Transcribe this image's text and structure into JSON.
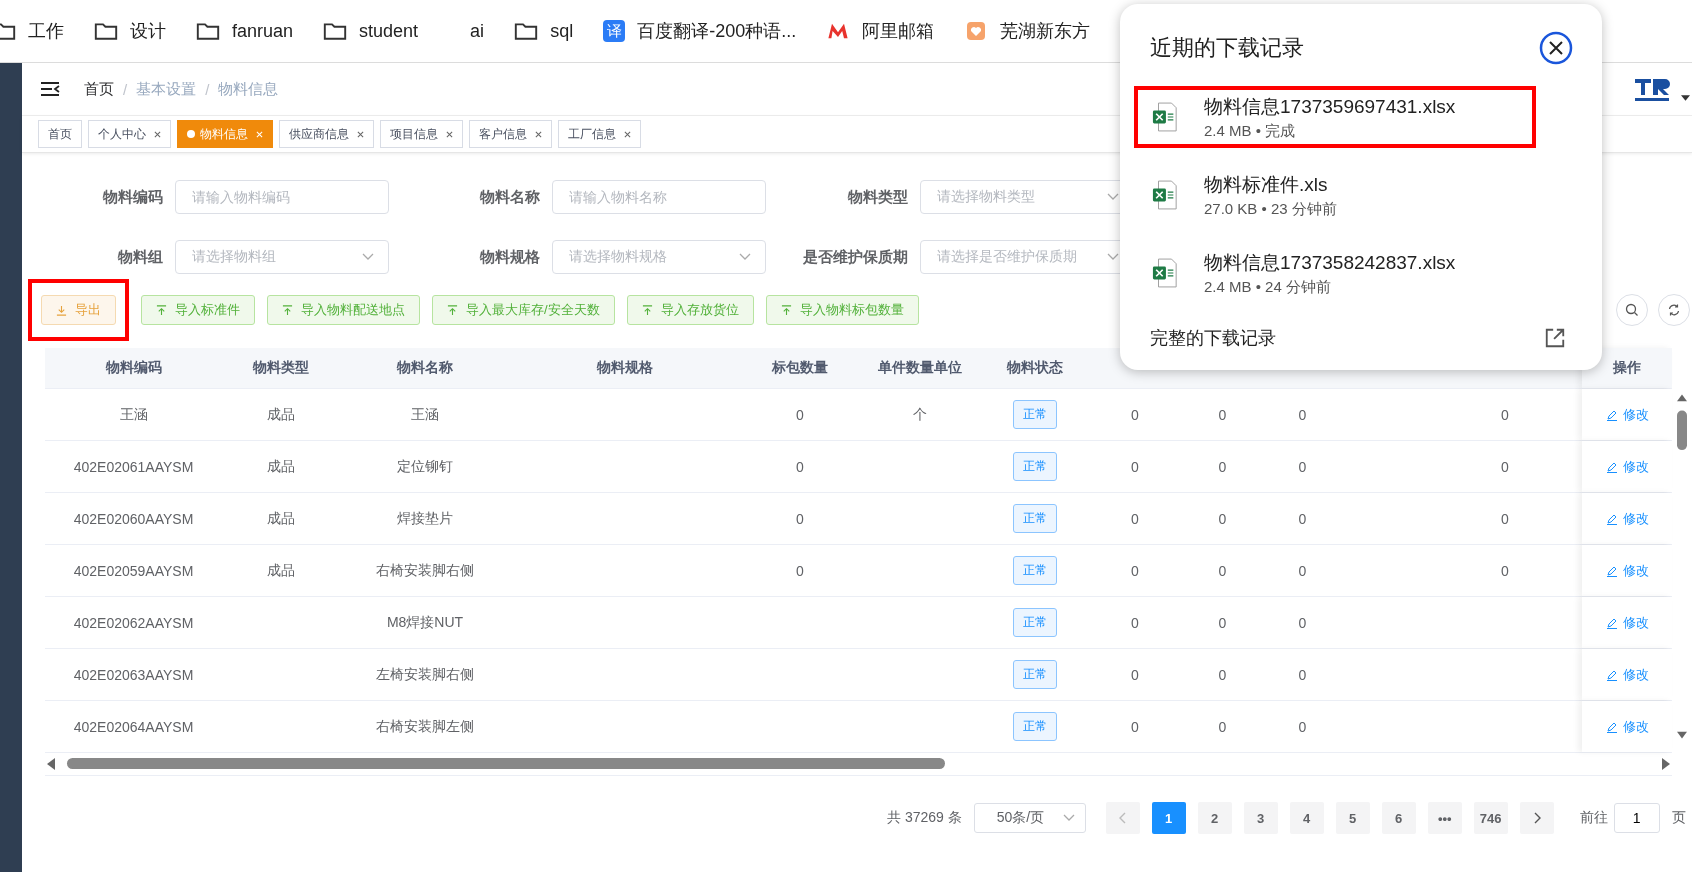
{
  "bookmarks": [
    {
      "kind": "folder",
      "label": "工作"
    },
    {
      "kind": "folder",
      "label": "设计"
    },
    {
      "kind": "folder",
      "label": "fanruan"
    },
    {
      "kind": "folder",
      "label": "student"
    },
    {
      "kind": "plain",
      "label": "ai"
    },
    {
      "kind": "folder",
      "label": "sql"
    },
    {
      "kind": "translate",
      "badge": "译",
      "label": "百度翻译-200种语..."
    },
    {
      "kind": "mail",
      "label": "阿里邮箱"
    },
    {
      "kind": "site",
      "label": "芜湖新东方"
    }
  ],
  "breadcrumb": {
    "items": [
      "首页",
      "基本设置",
      "物料信息"
    ],
    "separators": [
      "/",
      "/"
    ]
  },
  "tags": [
    {
      "label": "首页",
      "selected": false,
      "closable": false
    },
    {
      "label": "个人中心",
      "selected": false,
      "closable": true
    },
    {
      "label": "物料信息",
      "selected": true,
      "closable": true
    },
    {
      "label": "供应商信息",
      "selected": false,
      "closable": true
    },
    {
      "label": "项目信息",
      "selected": false,
      "closable": true
    },
    {
      "label": "客户信息",
      "selected": false,
      "closable": true
    },
    {
      "label": "工厂信息",
      "selected": false,
      "closable": true
    }
  ],
  "filters": [
    {
      "kind": "input",
      "label": "物料编码",
      "placeholder": "请输入物料编码"
    },
    {
      "kind": "input",
      "label": "物料名称",
      "placeholder": "请输入物料名称"
    },
    {
      "kind": "select",
      "label": "物料类型",
      "placeholder": "请选择物料类型"
    },
    {
      "kind": "select",
      "label": "物料组",
      "placeholder": "请选择物料组"
    },
    {
      "kind": "select",
      "label": "物料规格",
      "placeholder": "请选择物料规格"
    },
    {
      "kind": "select",
      "label": "是否维护保质期",
      "placeholder": "请选择是否维护保质期"
    }
  ],
  "toolbar": [
    {
      "kind": "export",
      "label": "导出",
      "highlighted": true
    },
    {
      "kind": "import",
      "label": "导入标准件",
      "highlighted": false
    },
    {
      "kind": "import",
      "label": "导入物料配送地点",
      "highlighted": false
    },
    {
      "kind": "import",
      "label": "导入最大库存/安全天数",
      "highlighted": false
    },
    {
      "kind": "import",
      "label": "导入存放货位",
      "highlighted": false
    },
    {
      "kind": "import",
      "label": "导入物料标包数量",
      "highlighted": false
    }
  ],
  "table": {
    "columns": [
      "物料编码",
      "物料类型",
      "物料名称",
      "物料规格",
      "标包数量",
      "单件数量单位",
      "物料状态",
      null,
      null,
      null,
      null,
      null
    ],
    "action_column": "操作",
    "rows": [
      {
        "cells": [
          {
            "kind": "text",
            "text": "王涵"
          },
          {
            "kind": "text",
            "text": "成品"
          },
          {
            "kind": "text",
            "text": "王涵"
          },
          null,
          {
            "kind": "text",
            "text": "0"
          },
          {
            "kind": "text",
            "text": "个"
          },
          {
            "kind": "status",
            "text": "正常"
          },
          {
            "kind": "text",
            "text": "0"
          },
          {
            "kind": "text",
            "text": "0"
          },
          {
            "kind": "text",
            "text": "0"
          },
          null,
          {
            "kind": "text",
            "text": "0"
          }
        ],
        "action": "修改"
      },
      {
        "cells": [
          {
            "kind": "text",
            "text": "402E02061AAYSM"
          },
          {
            "kind": "text",
            "text": "成品"
          },
          {
            "kind": "text",
            "text": "定位铆钉"
          },
          null,
          {
            "kind": "text",
            "text": "0"
          },
          null,
          {
            "kind": "status",
            "text": "正常"
          },
          {
            "kind": "text",
            "text": "0"
          },
          {
            "kind": "text",
            "text": "0"
          },
          {
            "kind": "text",
            "text": "0"
          },
          null,
          {
            "kind": "text",
            "text": "0"
          }
        ],
        "action": "修改"
      },
      {
        "cells": [
          {
            "kind": "text",
            "text": "402E02060AAYSM"
          },
          {
            "kind": "text",
            "text": "成品"
          },
          {
            "kind": "text",
            "text": "焊接垫片"
          },
          null,
          {
            "kind": "text",
            "text": "0"
          },
          null,
          {
            "kind": "status",
            "text": "正常"
          },
          {
            "kind": "text",
            "text": "0"
          },
          {
            "kind": "text",
            "text": "0"
          },
          {
            "kind": "text",
            "text": "0"
          },
          null,
          {
            "kind": "text",
            "text": "0"
          }
        ],
        "action": "修改"
      },
      {
        "cells": [
          {
            "kind": "text",
            "text": "402E02059AAYSM"
          },
          {
            "kind": "text",
            "text": "成品"
          },
          {
            "kind": "text",
            "text": "右椅安装脚右侧"
          },
          null,
          {
            "kind": "text",
            "text": "0"
          },
          null,
          {
            "kind": "status",
            "text": "正常"
          },
          {
            "kind": "text",
            "text": "0"
          },
          {
            "kind": "text",
            "text": "0"
          },
          {
            "kind": "text",
            "text": "0"
          },
          null,
          {
            "kind": "text",
            "text": "0"
          }
        ],
        "action": "修改"
      },
      {
        "cells": [
          {
            "kind": "text",
            "text": "402E02062AAYSM"
          },
          null,
          {
            "kind": "text",
            "text": "M8焊接NUT"
          },
          null,
          null,
          null,
          {
            "kind": "status",
            "text": "正常"
          },
          {
            "kind": "text",
            "text": "0"
          },
          {
            "kind": "text",
            "text": "0"
          },
          {
            "kind": "text",
            "text": "0"
          },
          null,
          null
        ],
        "action": "修改"
      },
      {
        "cells": [
          {
            "kind": "text",
            "text": "402E02063AAYSM"
          },
          null,
          {
            "kind": "text",
            "text": "左椅安装脚右侧"
          },
          null,
          null,
          null,
          {
            "kind": "status",
            "text": "正常"
          },
          {
            "kind": "text",
            "text": "0"
          },
          {
            "kind": "text",
            "text": "0"
          },
          {
            "kind": "text",
            "text": "0"
          },
          null,
          null
        ],
        "action": "修改"
      },
      {
        "cells": [
          {
            "kind": "text",
            "text": "402E02064AAYSM"
          },
          null,
          {
            "kind": "text",
            "text": "右椅安装脚左侧"
          },
          null,
          null,
          null,
          {
            "kind": "status",
            "text": "正常"
          },
          {
            "kind": "text",
            "text": "0"
          },
          {
            "kind": "text",
            "text": "0"
          },
          {
            "kind": "text",
            "text": "0"
          },
          null,
          null
        ],
        "action": "修改"
      }
    ]
  },
  "pagination": {
    "total": "共 37269 条",
    "page_size": "50条/页",
    "pages": [
      {
        "label": "1",
        "selected": true
      },
      {
        "label": "2",
        "selected": false
      },
      {
        "label": "3",
        "selected": false
      },
      {
        "label": "4",
        "selected": false
      },
      {
        "label": "5",
        "selected": false
      },
      {
        "label": "6",
        "selected": false
      },
      {
        "label": "•••",
        "selected": false
      },
      {
        "label": "746",
        "selected": false
      }
    ],
    "goto_label": "前往",
    "goto_value": "1",
    "goto_suffix": "页"
  },
  "downloads": {
    "title": "近期的下载记录",
    "items": [
      {
        "name": "物料信息1737359697431.xlsx",
        "meta": "2.4 MB • 完成",
        "highlighted": true
      },
      {
        "name": "物料标准件.xls",
        "meta": "27.0 KB • 23 分钟前",
        "highlighted": false
      },
      {
        "name": "物料信息1737358242837.xlsx",
        "meta": "2.4 MB • 24 分钟前",
        "highlighted": false
      }
    ],
    "footer": "完整的下载记录"
  }
}
